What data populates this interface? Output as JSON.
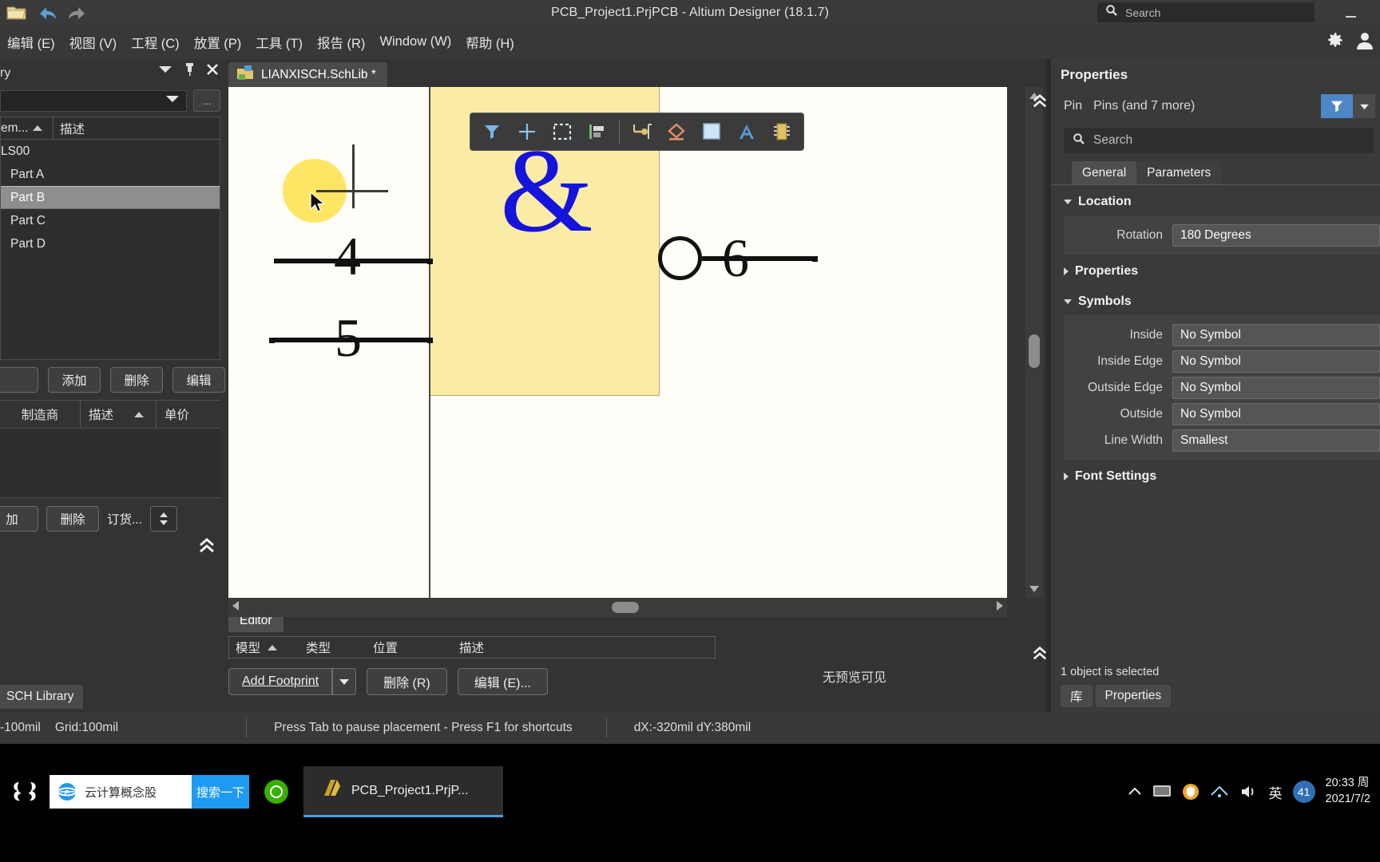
{
  "titlebar": {
    "title": "PCB_Project1.PrjPCB - Altium Designer (18.1.7)",
    "search_placeholder": "Search",
    "icons": [
      "open-folder-icon",
      "undo-icon",
      "redo-icon"
    ]
  },
  "menubar": {
    "items": [
      {
        "label": "编辑 (E)"
      },
      {
        "label": "视图 (V)"
      },
      {
        "label": "工程 (C)"
      },
      {
        "label": "放置 (P)"
      },
      {
        "label": "工具 (T)"
      },
      {
        "label": "报告 (R)"
      },
      {
        "label": "Window (W)"
      },
      {
        "label": "帮助 (H)"
      }
    ],
    "right_icons": [
      "gear-icon",
      "user-icon"
    ]
  },
  "left_panel": {
    "title": "ry",
    "combo_value": "",
    "ellipsis_label": "...",
    "table": {
      "columns": [
        "em...",
        "描述"
      ],
      "rows": [
        {
          "label": "LS00",
          "indent": false,
          "selected": false
        },
        {
          "label": "Part A",
          "indent": true,
          "selected": false
        },
        {
          "label": "Part B",
          "indent": true,
          "selected": true
        },
        {
          "label": "Part C",
          "indent": true,
          "selected": false
        },
        {
          "label": "Part D",
          "indent": true,
          "selected": false
        }
      ]
    },
    "buttons": [
      "添加",
      "删除",
      "编辑"
    ],
    "clipped_button": "",
    "table2": {
      "columns": [
        "制造商",
        "描述",
        "单价"
      ]
    },
    "buttons2": [
      "加",
      "删除"
    ],
    "order_label": "订货...",
    "bottom_tab": "SCH Library"
  },
  "editor": {
    "doc_tab": "LIANXISCH.SchLib *",
    "toolbar_icons": [
      "filter-icon",
      "crosshair-icon",
      "selection-box-icon",
      "align-icon",
      "place-pin-icon",
      "place-polygon-icon",
      "place-rectangle-icon",
      "place-text-icon",
      "place-ic-icon"
    ],
    "schematic": {
      "symbol_char": "&",
      "pins": [
        {
          "number": "4"
        },
        {
          "number": "5"
        },
        {
          "number": "6"
        }
      ]
    },
    "bottom_tab": "Editor",
    "model_table_columns": [
      "模型",
      "类型",
      "位置",
      "描述"
    ],
    "no_preview": "无预览可见",
    "footprint_buttons": {
      "add": "Add Footprint",
      "delete": "删除 (R)",
      "edit": "编辑 (E)..."
    }
  },
  "properties": {
    "title": "Properties",
    "object_label": "Pin",
    "object_type": "Pins (and 7 more)",
    "search_placeholder": "Search",
    "tabs": [
      {
        "label": "General",
        "active": true
      },
      {
        "label": "Parameters",
        "active": false
      }
    ],
    "sections": [
      {
        "name": "Location",
        "expanded": true
      },
      {
        "name": "Properties",
        "expanded": false
      },
      {
        "name": "Symbols",
        "expanded": true
      },
      {
        "name": "Font Settings",
        "expanded": false
      }
    ],
    "location": {
      "rotation_label": "Rotation",
      "rotation_value": "180 Degrees"
    },
    "symbols": [
      {
        "label": "Inside",
        "value": "No Symbol"
      },
      {
        "label": "Inside Edge",
        "value": "No Symbol"
      },
      {
        "label": "Outside Edge",
        "value": "No Symbol"
      },
      {
        "label": "Outside",
        "value": "No Symbol"
      },
      {
        "label": "Line Width",
        "value": "Smallest"
      }
    ],
    "status": "1 object is selected",
    "bottom_tabs": [
      "库",
      "Properties"
    ]
  },
  "statusbar": {
    "snap": "-100mil",
    "grid": "Grid:100mil",
    "hint": "Press Tab to pause placement - Press F1 for shortcuts",
    "coords": "dX:-320mil dY:380mil"
  },
  "taskbar": {
    "search_text": "云计算概念股",
    "search_button": "搜索一下",
    "task_label": "PCB_Project1.PrjP...",
    "tray_badge": "41",
    "tray_lang": "英",
    "clock_time": "20:33 周",
    "clock_date": "2021/7/2"
  },
  "colors": {
    "accent": "#4e87c7",
    "symbol_blue": "#1414dc",
    "highlight_yellow": "#ffe14a",
    "sheet_yellow": "#fbeca5"
  }
}
